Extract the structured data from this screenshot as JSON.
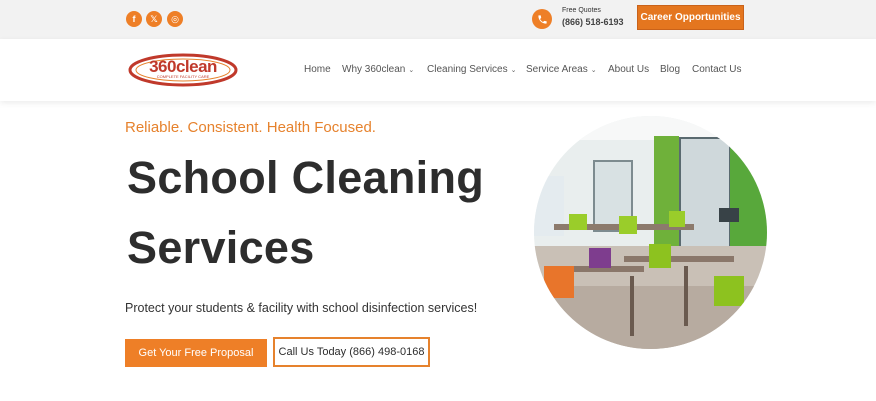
{
  "topbar": {
    "social": [
      {
        "icon": "facebook-icon",
        "glyph": "f"
      },
      {
        "icon": "x-twitter-icon",
        "glyph": "𝕏"
      },
      {
        "icon": "instagram-icon",
        "glyph": "◎"
      }
    ],
    "free_quotes_label": "Free Quotes",
    "free_quotes_phone": "(866) 518-6193",
    "career_button": "Career Opportunities"
  },
  "brand": {
    "logo_text": "360clean",
    "logo_tagline": "COMPLETE FACILITY CARE",
    "accent": "#ee7f27",
    "logo_red": "#c0392b"
  },
  "nav": {
    "items": [
      {
        "label": "Home",
        "dropdown": false
      },
      {
        "label": "Why 360clean",
        "dropdown": true
      },
      {
        "label": "Cleaning Services",
        "dropdown": true
      },
      {
        "label": "Service Areas",
        "dropdown": true
      },
      {
        "label": "About Us",
        "dropdown": false
      },
      {
        "label": "Blog",
        "dropdown": false
      },
      {
        "label": "Contact Us",
        "dropdown": false
      }
    ]
  },
  "hero": {
    "tagline": "Reliable. Consistent. Health Focused.",
    "title_line1": "School Cleaning",
    "title_line2": "Services",
    "subtitle": "Protect your students & facility with school disinfection services!",
    "primary_button": "Get Your Free Proposal",
    "secondary_button": "Call Us Today (866) 498-0168"
  }
}
